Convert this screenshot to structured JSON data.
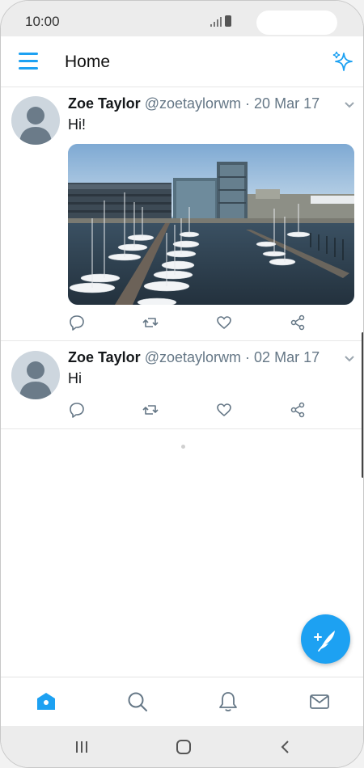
{
  "status_bar": {
    "time": "10:00"
  },
  "header": {
    "title": "Home"
  },
  "tweets": [
    {
      "name": "Zoe Taylor",
      "handle": "@zoetaylorwm",
      "date": "20 Mar 17",
      "text": "Hi!",
      "has_image": true
    },
    {
      "name": "Zoe Taylor",
      "handle": "@zoetaylorwm",
      "date": "02 Mar 17",
      "text": "Hi",
      "has_image": false
    }
  ],
  "bottom_nav": [
    "home-icon",
    "search-icon",
    "bell-icon",
    "mail-icon"
  ],
  "colors": {
    "accent": "#1da1f2",
    "text": "#14171a",
    "muted": "#657786"
  }
}
